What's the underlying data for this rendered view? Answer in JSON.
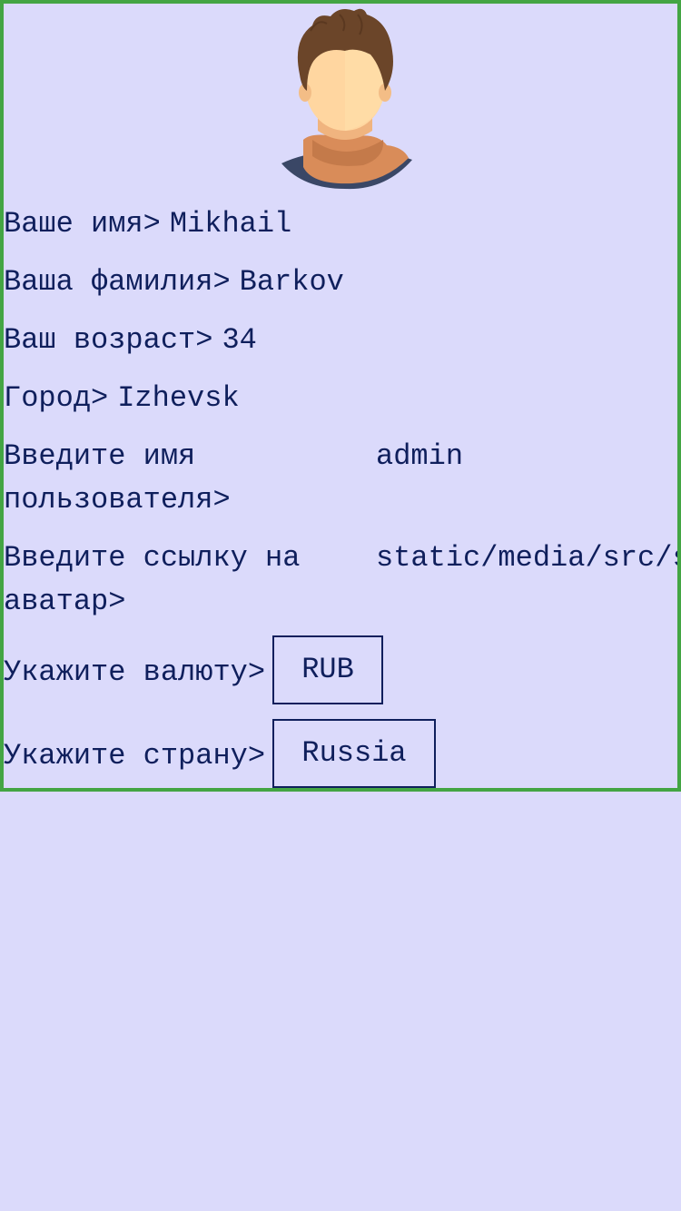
{
  "profile": {
    "first_name_label": "Ваше имя>",
    "first_name_value": "Mikhail",
    "last_name_label": "Ваша фамилия>",
    "last_name_value": "Barkov",
    "age_label": "Ваш возраст>",
    "age_value": "34",
    "city_label": "Город>",
    "city_value": "Izhevsk",
    "username_label": "Введите имя пользователя>",
    "username_value": "admin",
    "avatar_link_label": "Введите ссылку на аватар>",
    "avatar_link_value": "static/media/src/s",
    "currency_label": "Укажите валюту>",
    "currency_value": "RUB",
    "country_label": "Укажите страну>",
    "country_value": "Russia"
  },
  "colors": {
    "background": "#dbdafb",
    "panel_border": "#43a543",
    "text": "#0f1f5c"
  }
}
